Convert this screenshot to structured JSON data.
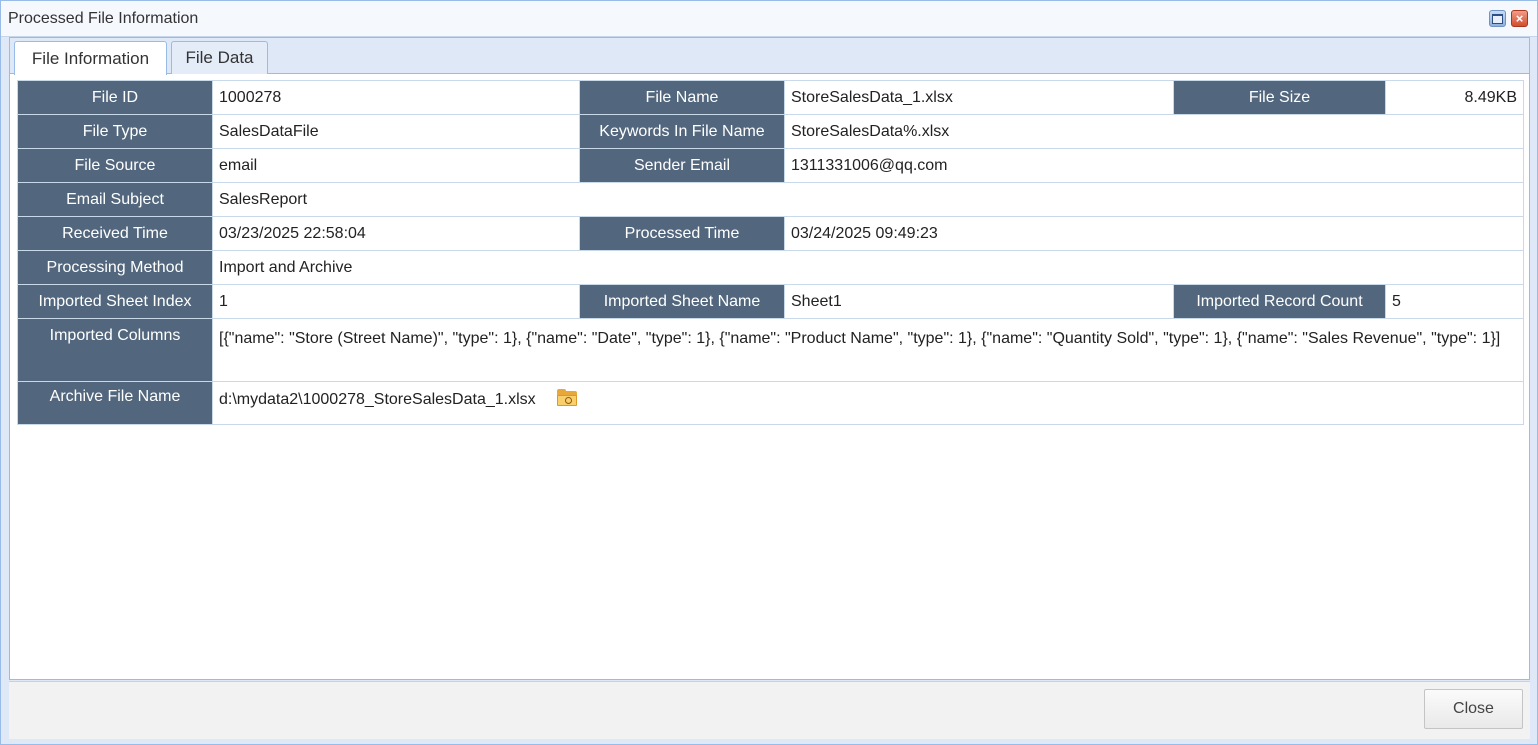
{
  "window": {
    "title": "Processed File Information"
  },
  "tabs": [
    {
      "label": "File Information",
      "active": true
    },
    {
      "label": "File Data",
      "active": false
    }
  ],
  "fields": {
    "file_id": {
      "label": "File ID",
      "value": "1000278"
    },
    "file_name": {
      "label": "File Name",
      "value": "StoreSalesData_1.xlsx"
    },
    "file_size": {
      "label": "File Size",
      "value": "8.49KB"
    },
    "file_type": {
      "label": "File Type",
      "value": "SalesDataFile"
    },
    "keywords": {
      "label": "Keywords In File Name",
      "value": "StoreSalesData%.xlsx"
    },
    "file_source": {
      "label": "File Source",
      "value": "email"
    },
    "sender_email": {
      "label": "Sender Email",
      "value": "1311331006@qq.com"
    },
    "email_subject": {
      "label": "Email Subject",
      "value": "SalesReport"
    },
    "received_time": {
      "label": "Received Time",
      "value": "03/23/2025 22:58:04"
    },
    "processed_time": {
      "label": "Processed Time",
      "value": "03/24/2025 09:49:23"
    },
    "processing_method": {
      "label": "Processing Method",
      "value": "Import and Archive"
    },
    "sheet_index": {
      "label": "Imported Sheet Index",
      "value": "1"
    },
    "sheet_name": {
      "label": "Imported Sheet Name",
      "value": "Sheet1"
    },
    "record_count": {
      "label": "Imported Record Count",
      "value": "5"
    },
    "imported_columns": {
      "label": "Imported Columns",
      "value": "[{\"name\": \"Store (Street Name)\", \"type\": 1}, {\"name\": \"Date\", \"type\": 1}, {\"name\": \"Product Name\", \"type\": 1}, {\"name\": \"Quantity Sold\", \"type\": 1}, {\"name\": \"Sales Revenue\", \"type\": 1}]"
    },
    "archive_file_name": {
      "label": "Archive File Name",
      "value": "d:\\mydata2\\1000278_StoreSalesData_1.xlsx"
    }
  },
  "icons": {
    "archive_open": "folder-search-icon"
  },
  "footer": {
    "close_label": "Close"
  },
  "colors": {
    "label_bg": "#52677d",
    "border": "#99bbe8",
    "tab_bg": "#dfe8f6"
  }
}
